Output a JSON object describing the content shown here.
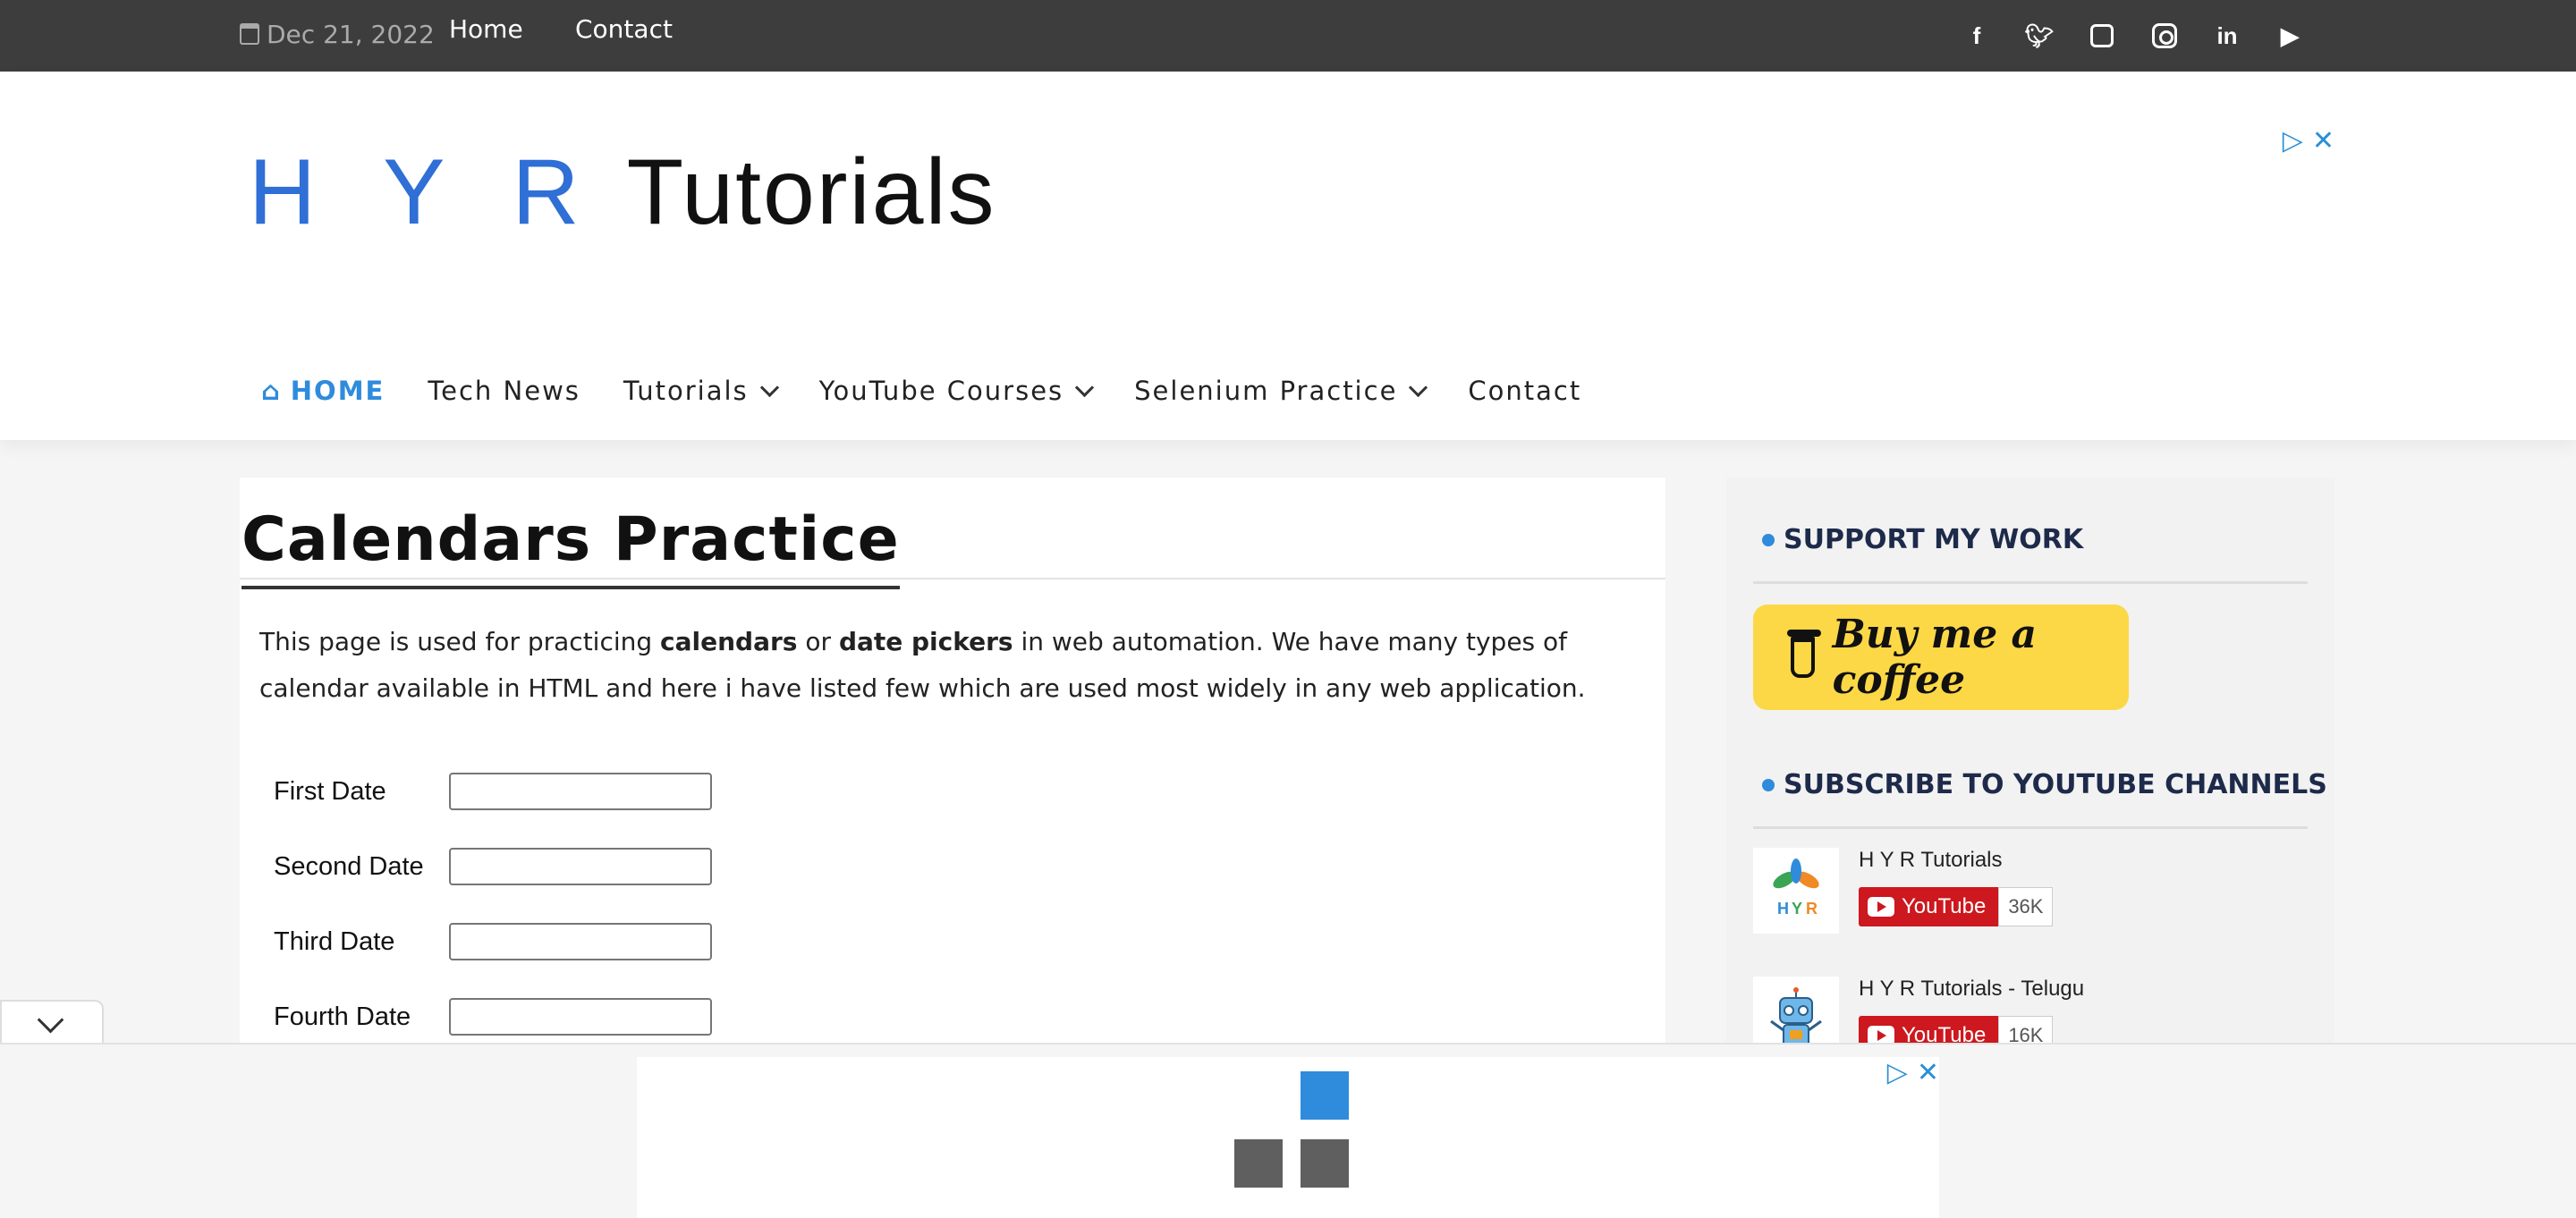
{
  "topbar": {
    "date": "Dec 21, 2022",
    "links": [
      "Home",
      "Contact"
    ],
    "social": [
      "facebook-icon",
      "twitter-icon",
      "github-icon",
      "instagram-icon",
      "linkedin-icon",
      "youtube-icon"
    ]
  },
  "logo": {
    "part1": "H Y R",
    "part2": "Tutorials"
  },
  "nav": {
    "items": [
      {
        "label": "HOME"
      },
      {
        "label": "Tech News"
      },
      {
        "label": "Tutorials"
      },
      {
        "label": "YouTube Courses"
      },
      {
        "label": "Selenium Practice"
      },
      {
        "label": "Contact"
      }
    ]
  },
  "main": {
    "title": "Calendars Practice",
    "intro": {
      "t1": "This page is used for practicing ",
      "b1": "calendars",
      "t2": " or ",
      "b2": "date pickers",
      "t3": " in web automation. We have many types of calendar available in HTML and here i have listed few which are used most widely in any web application."
    },
    "fields": [
      "First Date",
      "Second Date",
      "Third Date",
      "Fourth Date"
    ]
  },
  "sidebar": {
    "support_title": "SUPPORT MY WORK",
    "coffee_label": "Buy me a coffee",
    "subscribe_title": "SUBSCRIBE TO YOUTUBE CHANNELS",
    "channels": [
      {
        "name": "H Y R Tutorials",
        "button": "YouTube",
        "count": "36K"
      },
      {
        "name": "H Y R Tutorials - Telugu",
        "button": "YouTube",
        "count": "16K"
      }
    ]
  },
  "colors": {
    "accent": "#2f8bdc",
    "topbar": "#3d3d3d",
    "coffee": "#fcd846",
    "youtube": "#cc181e"
  }
}
